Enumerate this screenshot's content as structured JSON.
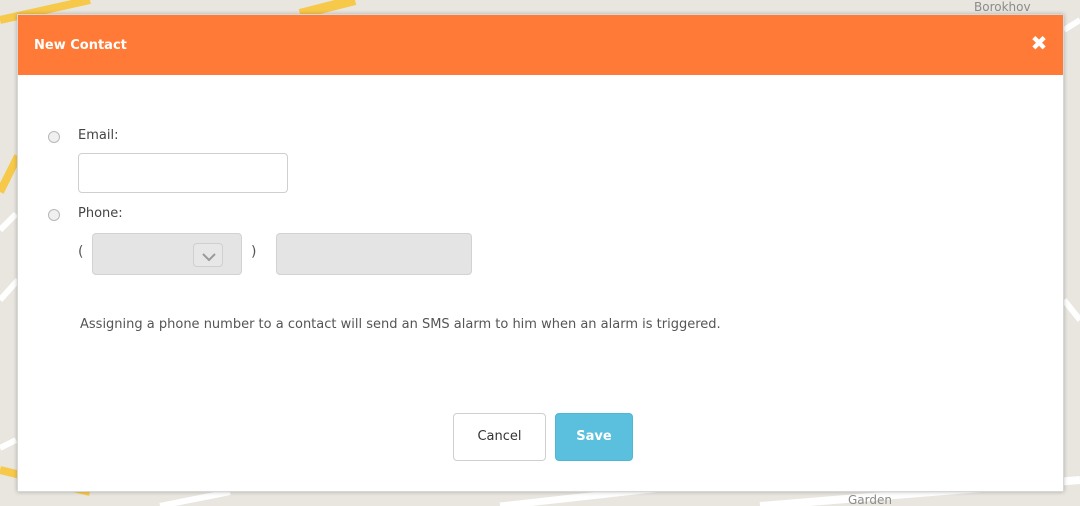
{
  "map": {
    "labels": [
      "Borokhov",
      "Garden"
    ]
  },
  "dialog": {
    "title": "New Contact",
    "close_icon": "close-icon",
    "email": {
      "label": "Email:",
      "value": ""
    },
    "phone": {
      "label": "Phone:",
      "open_paren": "(",
      "close_paren": ")",
      "country_code_value": "",
      "number_value": ""
    },
    "info_text": "Assigning a phone number to a contact will send an SMS alarm to him when an alarm is triggered.",
    "buttons": {
      "cancel": "Cancel",
      "save": "Save"
    }
  },
  "colors": {
    "header": "#ff7a36",
    "save_button": "#5bc0de",
    "map_background": "#e8e6df"
  }
}
